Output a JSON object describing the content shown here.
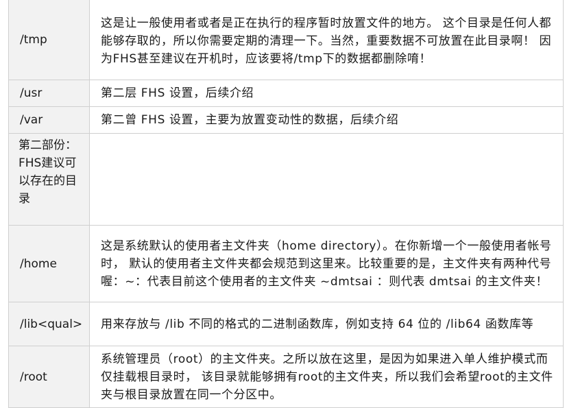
{
  "rows": [
    {
      "key": "/tmp",
      "value": "这是让一般使用者或者是正在执行的程序暂时放置文件的地方。 这个目录是任何人都能够存取的，所以你需要定期的清理一下。当然，重要数据不可放置在此目录啊！ 因为FHS甚至建议在开机时，应该要将/tmp下的数据都删除唷！"
    },
    {
      "key": "/usr",
      "value": "第二层 FHS 设置，后续介绍"
    },
    {
      "key": "/var",
      "value": "第二曾 FHS 设置，主要为放置变动性的数据，后续介绍"
    },
    {
      "key": "第二部份：FHS建议可以存在的目录",
      "value": ""
    },
    {
      "key": "/home",
      "value": "这是系统默认的使用者主文件夹（home directory）。在你新增一个一般使用者帐号时， 默认的使用者主文件夹都会规范到这里来。比较重要的是，主文件夹有两种代号喔：~：代表目前这个使用者的主文件夹 ~dmtsai ：则代表 dmtsai 的主文件夹！"
    },
    {
      "key": "/lib<qual>",
      "value": "用来存放与 /lib 不同的格式的二进制函数库，例如支持 64 位的 /lib64 函数库等"
    },
    {
      "key": "/root",
      "value": "系统管理员（root）的主文件夹。之所以放在这里，是因为如果进入单人维护模式而仅挂载根目录时， 该目录就能够拥有root的主文件夹，所以我们会希望root的主文件夹与根目录放置在同一个分区中。"
    }
  ]
}
